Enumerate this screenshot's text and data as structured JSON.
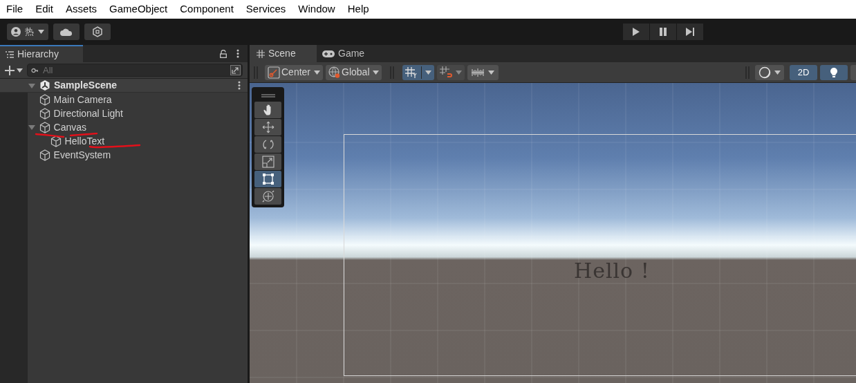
{
  "menu_bar": {
    "items": [
      "File",
      "Edit",
      "Assets",
      "GameObject",
      "Component",
      "Services",
      "Window",
      "Help"
    ]
  },
  "main_toolbar": {
    "account_label": "热"
  },
  "hierarchy": {
    "title": "Hierarchy",
    "search": {
      "placeholder": "All"
    },
    "scene": {
      "name": "SampleScene",
      "expanded": true,
      "children": [
        {
          "name": "Main Camera"
        },
        {
          "name": "Directional Light"
        },
        {
          "name": "Canvas",
          "expanded": true,
          "children": [
            {
              "name": "HelloText"
            }
          ]
        },
        {
          "name": "EventSystem"
        }
      ]
    }
  },
  "scene_view": {
    "tabs": [
      {
        "label": "Scene",
        "selected": true
      },
      {
        "label": "Game",
        "selected": false
      }
    ],
    "pivot_mode": "Center",
    "pivot_rotation": "Global",
    "grid_snapping_on": true,
    "mode_2d_label": "2D",
    "mode_2d_on": true,
    "lighting_on": true,
    "tools": [
      {
        "kind": "hand",
        "selected": false
      },
      {
        "kind": "move",
        "selected": false
      },
      {
        "kind": "rotate",
        "selected": false
      },
      {
        "kind": "scale",
        "selected": false
      },
      {
        "kind": "rect",
        "selected": true
      },
      {
        "kind": "transform",
        "selected": false
      }
    ],
    "canvas_text": "Hello !"
  }
}
